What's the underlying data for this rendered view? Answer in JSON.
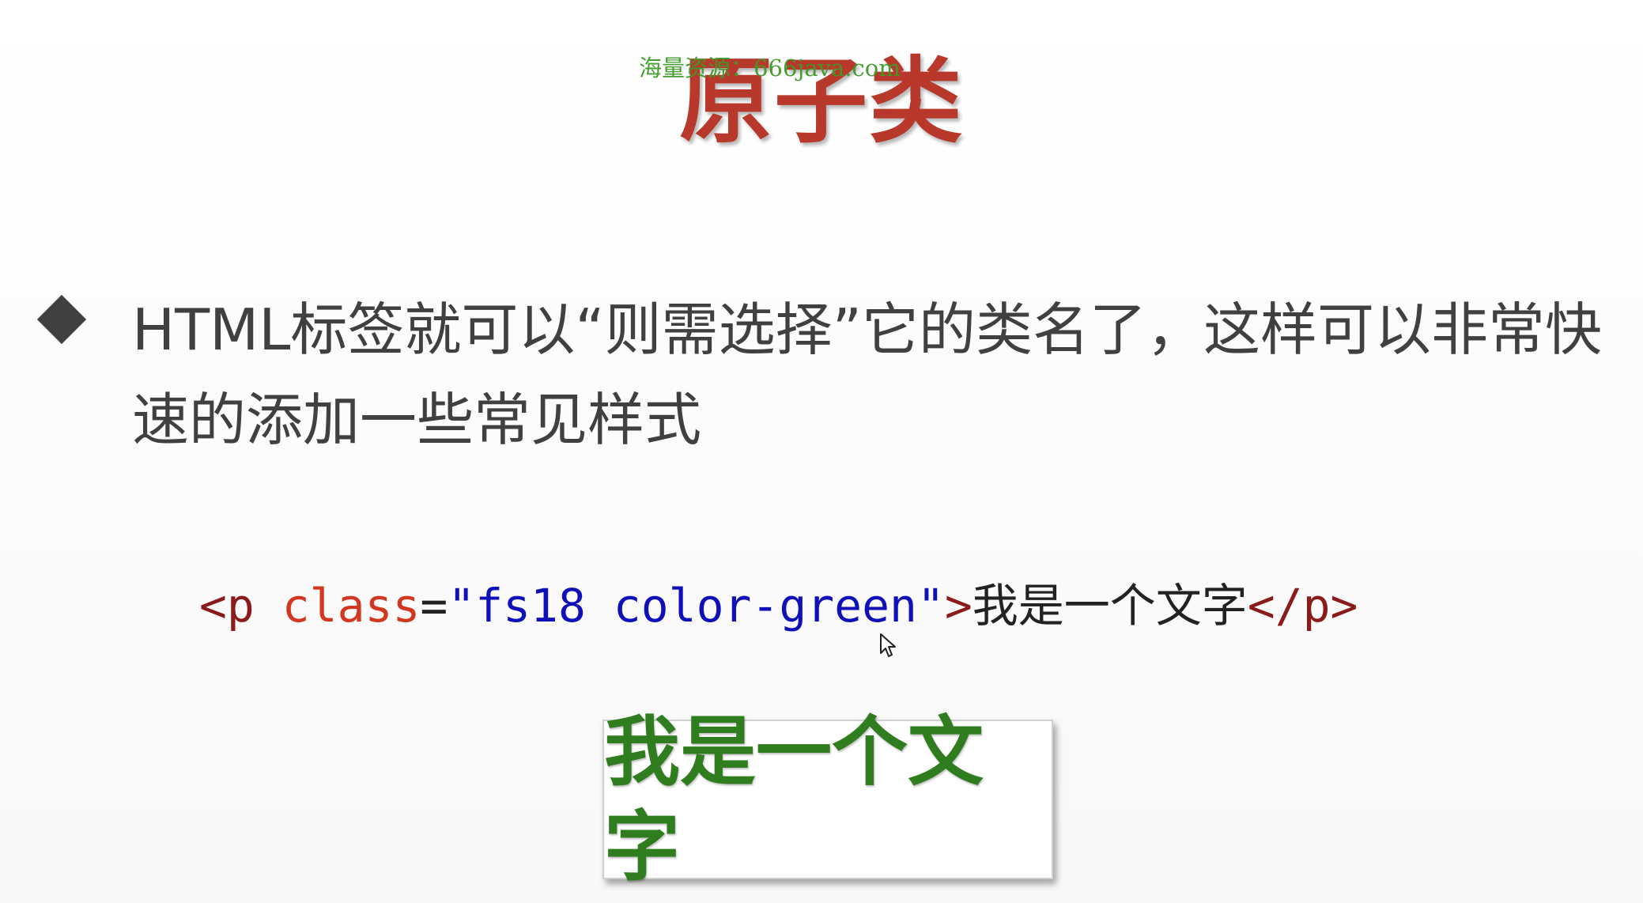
{
  "slide": {
    "title": "原子类",
    "watermark": "海量资源：666java.com",
    "bullet_text": "HTML标签就可以“则需选择”它的类名了，这样可以非常快速的添加一些常见样式",
    "code": {
      "open_bracket": "<",
      "tag": "p",
      "attr": "class",
      "equals": "=",
      "value": "\"fs18 color-green\"",
      "close_bracket": ">",
      "content": "我是一个文字",
      "end_tag": "</p>"
    },
    "demo_text": "我是一个文字"
  },
  "colors": {
    "title": "#b8392c",
    "watermark": "#3d9a28",
    "body_text": "#404040",
    "code_tag": "#8b1a1a",
    "code_attr": "#d2381f",
    "code_value": "#1010b8",
    "demo_text": "#2f7d1f"
  },
  "icons": {
    "bullet": "diamond-bullet-icon",
    "cursor": "mouse-pointer-icon"
  }
}
